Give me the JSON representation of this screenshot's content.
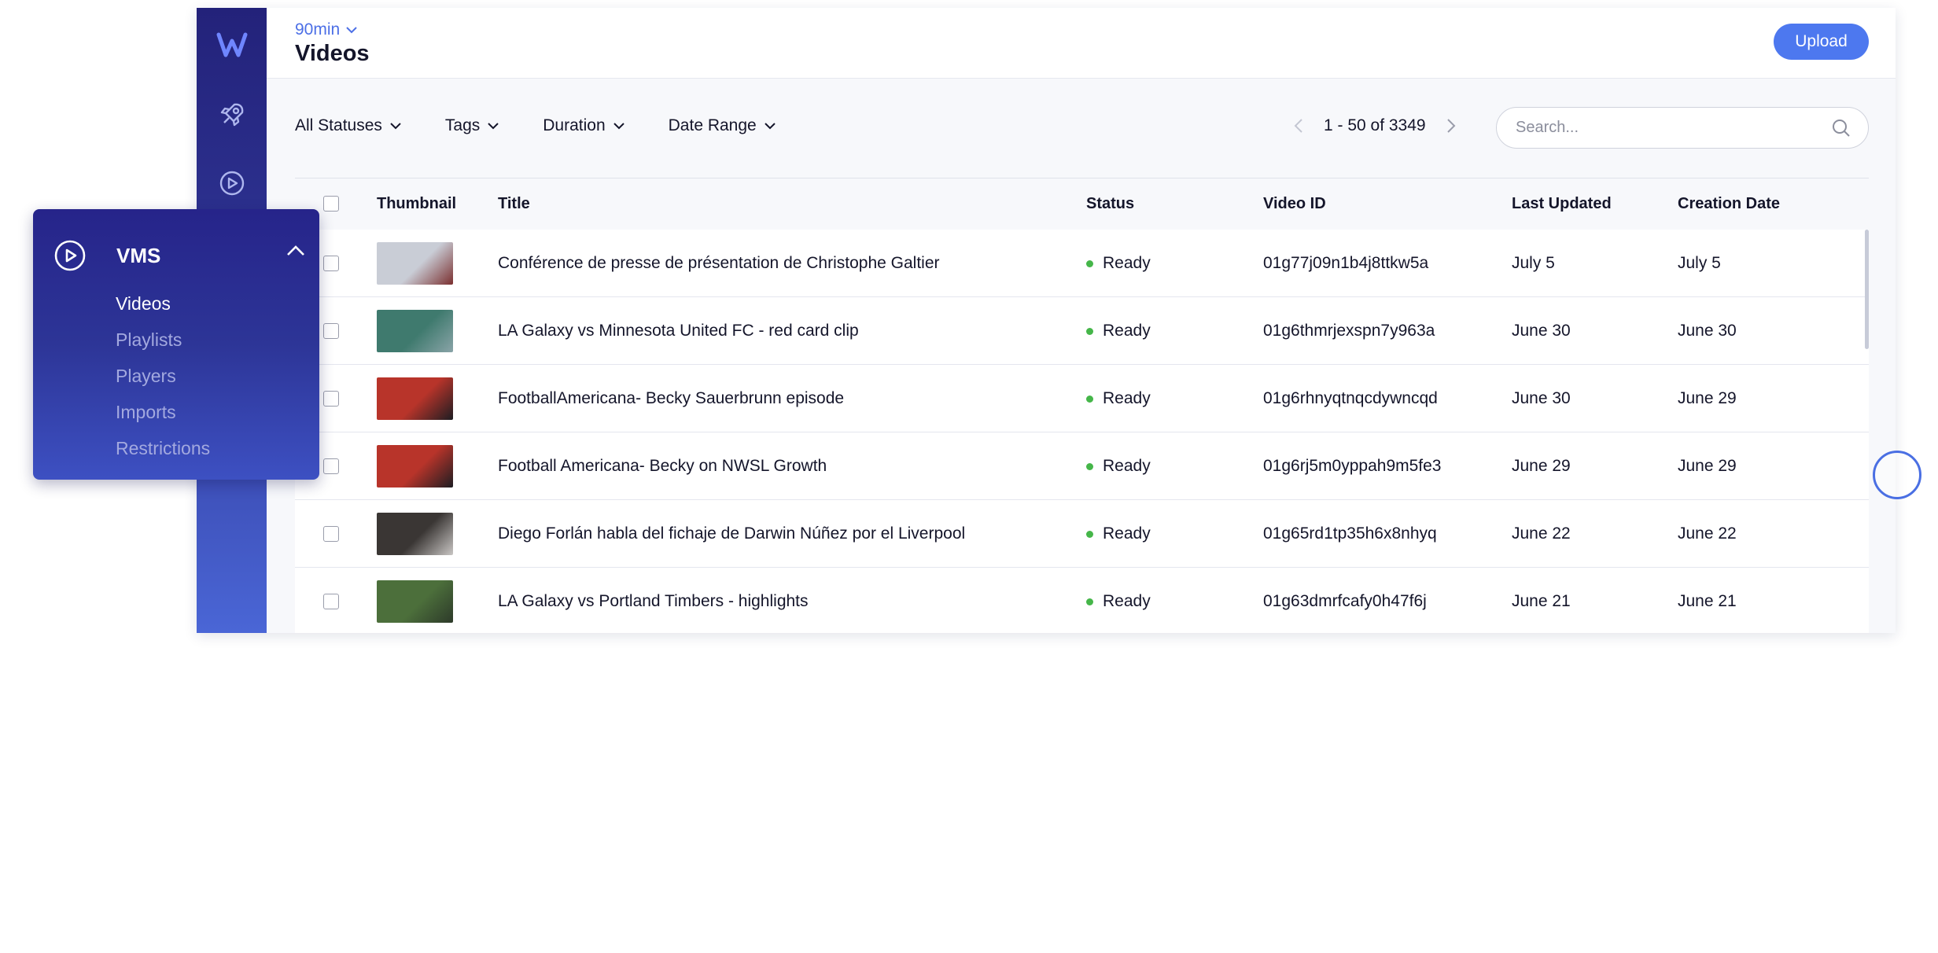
{
  "header": {
    "org_name": "90min",
    "page_title": "Videos",
    "upload_label": "Upload"
  },
  "filters": {
    "statuses": "All Statuses",
    "tags": "Tags",
    "duration": "Duration",
    "date_range": "Date Range"
  },
  "pagination": {
    "range_text": "1 - 50 of 3349"
  },
  "search": {
    "placeholder": "Search..."
  },
  "table": {
    "columns": [
      "Thumbnail",
      "Title",
      "Status",
      "Video ID",
      "Last Updated",
      "Creation Date"
    ],
    "rows": [
      {
        "title": "Conférence de presse de présentation de Christophe Galtier",
        "status": "Ready",
        "video_id": "01g77j09n1b4j8ttkw5a",
        "last_updated": "July 5",
        "created": "July 5",
        "thumb_colors": [
          "#c9cdd6",
          "#7a2f2f"
        ]
      },
      {
        "title": "LA Galaxy vs Minnesota United FC - red card clip",
        "status": "Ready",
        "video_id": "01g6thmrjexspn7y963a",
        "last_updated": "June 30",
        "created": "June 30",
        "thumb_colors": [
          "#3f7a6e",
          "#8aa4a8"
        ]
      },
      {
        "title": "FootballAmericana- Becky Sauerbrunn episode",
        "status": "Ready",
        "video_id": "01g6rhnyqtnqcdywncqd",
        "last_updated": "June 30",
        "created": "June 29",
        "thumb_colors": [
          "#b8342a",
          "#1d1d22"
        ]
      },
      {
        "title": "Football Americana- Becky on NWSL Growth",
        "status": "Ready",
        "video_id": "01g6rj5m0yppah9m5fe3",
        "last_updated": "June 29",
        "created": "June 29",
        "thumb_colors": [
          "#b8342a",
          "#1d1d22"
        ]
      },
      {
        "title": "Diego Forlán habla del fichaje de Darwin Núñez por el Liverpool",
        "status": "Ready",
        "video_id": "01g65rd1tp35h6x8nhyq",
        "last_updated": "June 22",
        "created": "June 22",
        "thumb_colors": [
          "#3a3634",
          "#c9c6c4"
        ]
      },
      {
        "title": "LA Galaxy vs Portland Timbers - highlights",
        "status": "Ready",
        "video_id": "01g63dmrfcafy0h47f6j",
        "last_updated": "June 21",
        "created": "June 21",
        "thumb_colors": [
          "#4c6f3b",
          "#2d3a2a"
        ]
      }
    ]
  },
  "flyout": {
    "title": "VMS",
    "items": [
      "Videos",
      "Playlists",
      "Players",
      "Imports",
      "Restrictions"
    ],
    "active": "Videos"
  },
  "colors": {
    "accent": "#4d78ef",
    "status_ready": "#45b649",
    "rail_top": "#23227a",
    "rail_bottom": "#4a66d6"
  }
}
